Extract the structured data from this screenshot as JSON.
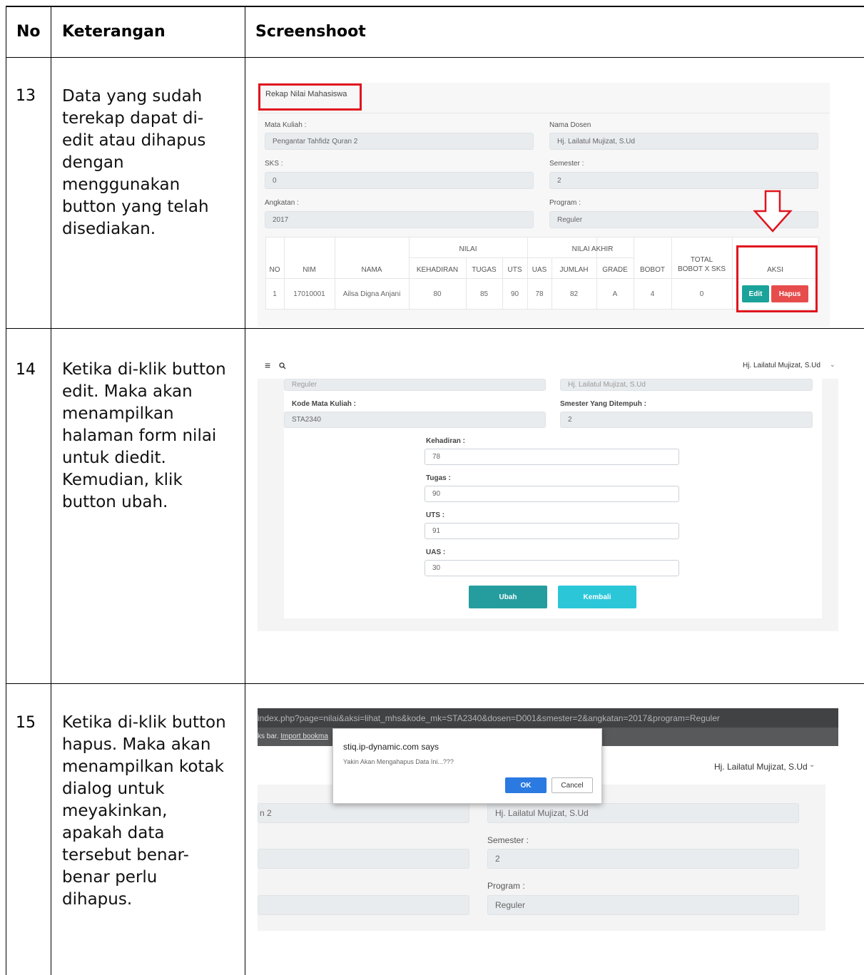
{
  "header": {
    "no": "No",
    "keterangan": "Keterangan",
    "screenshot": "Screenshoot"
  },
  "rows": [
    {
      "no": "13",
      "text_lines": [
        "Data yang sudah",
        "terekap dapat di-",
        "edit atau dihapus",
        "dengan",
        "menggunakan",
        "button yang telah",
        "disediakan."
      ],
      "shot": {
        "title": "Rekap Nilai Mahasiswa",
        "fields": {
          "mata_kuliah_label": "Mata Kuliah :",
          "mata_kuliah_value": "Pengantar Tahfidz Quran 2",
          "nama_dosen_label": "Nama Dosen",
          "nama_dosen_value": "Hj. Lailatul Mujizat, S.Ud",
          "sks_label": "SKS :",
          "sks_value": "0",
          "semester_label": "Semester :",
          "semester_value": "2",
          "angkatan_label": "Angkatan :",
          "angkatan_value": "2017",
          "program_label": "Program :",
          "program_value": "Reguler"
        },
        "table": {
          "group_nilai": "NILAI",
          "group_nilai_akhir": "NILAI AKHIR",
          "total_line1": "TOTAL",
          "total_line2": "BOBOT X SKS",
          "columns": [
            "NO",
            "NIM",
            "NAMA",
            "KEHADIRAN",
            "TUGAS",
            "UTS",
            "UAS",
            "JUMLAH",
            "GRADE",
            "BOBOT",
            "AKSI"
          ],
          "row": [
            "1",
            "17010001",
            "Ailsa Digna Anjani",
            "80",
            "85",
            "90",
            "78",
            "82",
            "A",
            "4",
            "0"
          ]
        },
        "edit_label": "Edit",
        "hapus_label": "Hapus"
      }
    },
    {
      "no": "14",
      "text_lines": [
        "Ketika di-klik button",
        "edit. Maka akan",
        "menampilkan",
        "halaman form nilai",
        "untuk diedit.",
        "Kemudian, klik",
        "button ubah."
      ],
      "shot": {
        "user_name": "Hj. Lailatul Mujizat, S.Ud",
        "top_left_value": "Reguler",
        "top_right_value": "Hj. Lailatul Mujizat, S.Ud",
        "kode_label": "Kode Mata Kuliah :",
        "kode_value": "STA2340",
        "smester_label": "Smester Yang Ditempuh :",
        "smester_value": "2",
        "kehadiran_label": "Kehadiran :",
        "kehadiran_value": "78",
        "tugas_label": "Tugas :",
        "tugas_value": "90",
        "uts_label": "UTS :",
        "uts_value": "91",
        "uas_label": "UAS :",
        "uas_value": "30",
        "ubah_label": "Ubah",
        "kembali_label": "Kembali"
      }
    },
    {
      "no": "15",
      "text_lines": [
        "Ketika di-klik button",
        "hapus. Maka akan",
        "menampilkan kotak",
        "dialog untuk",
        "meyakinkan,",
        "apakah data",
        "tersebut benar-",
        "benar perlu",
        "dihapus."
      ],
      "shot": {
        "url": "index.php?page=nilai&aksi=lihat_mhs&kode_mk=STA2340&dosen=D001&smester=2&angkatan=2017&program=Reguler",
        "bookmarks_text": "ks bar.",
        "import_link": "Import bookma",
        "dialog_title": "stiq.ip-dynamic.com says",
        "dialog_message": "Yakin Akan Mengahapus Data Ini...???",
        "ok_label": "OK",
        "cancel_label": "Cancel",
        "user_name": "Hj. Lailatul Mujizat, S.Ud",
        "left_value": "n 2",
        "dosen_value": "Hj. Lailatul Mujizat, S.Ud",
        "semester_label": "Semester :",
        "semester_value": "2",
        "program_label": "Program :",
        "program_value": "Reguler"
      }
    }
  ]
}
